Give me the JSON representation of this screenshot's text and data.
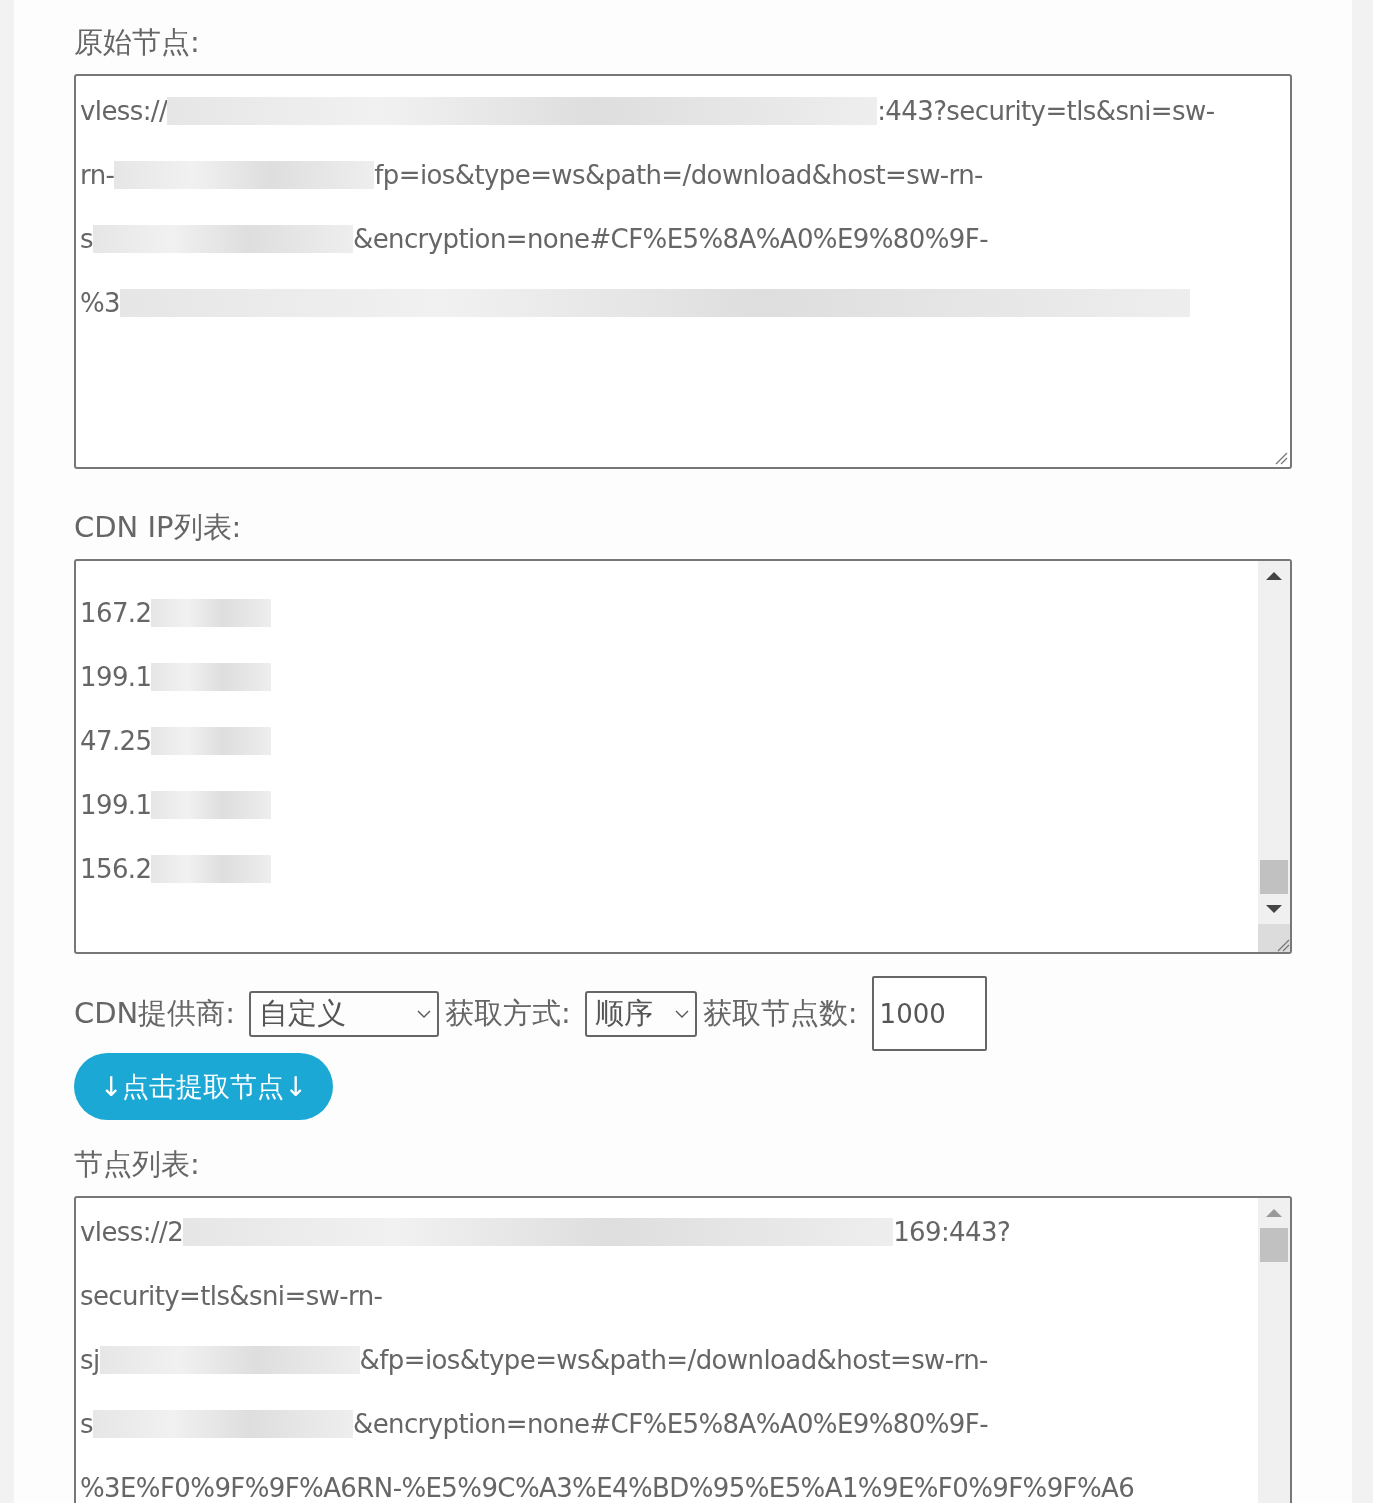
{
  "original_nodes": {
    "label": "原始节点:",
    "lines": [
      [
        {
          "kind": "text",
          "text": "vless://"
        },
        {
          "kind": "blurxl"
        },
        {
          "kind": "text",
          "text": ":443?security=tls&sni=sw-"
        }
      ],
      [
        {
          "kind": "text",
          "text": "rn-"
        },
        {
          "kind": "blurm"
        },
        {
          "kind": "text",
          "text": "fp=ios&type=ws&path=/download&host=sw-rn-"
        }
      ],
      [
        {
          "kind": "text",
          "text": "s"
        },
        {
          "kind": "blurm"
        },
        {
          "kind": "text",
          "text": "&encryption=none#CF%E5%8A%A0%E9%80%9F-"
        }
      ],
      [
        {
          "kind": "text",
          "text": "%3"
        },
        {
          "kind": "blurfull"
        }
      ]
    ]
  },
  "cdn_ip_list": {
    "label": "CDN IP列表:",
    "lines": [
      [
        {
          "kind": "text",
          "text": "167.2"
        },
        {
          "kind": "blurs"
        }
      ],
      [
        {
          "kind": "text",
          "text": "199.1"
        },
        {
          "kind": "blurs"
        }
      ],
      [
        {
          "kind": "text",
          "text": "47.25"
        },
        {
          "kind": "blurs"
        }
      ],
      [
        {
          "kind": "text",
          "text": "199.1"
        },
        {
          "kind": "blurs"
        }
      ],
      [
        {
          "kind": "text",
          "text": "156.2"
        },
        {
          "kind": "blurs"
        }
      ]
    ]
  },
  "options": {
    "provider": {
      "label": "CDN提供商:",
      "value": "自定义"
    },
    "method": {
      "label": "获取方式:",
      "value": "顺序"
    },
    "count": {
      "label": "获取节点数:",
      "value": "1000"
    }
  },
  "extract_button": "↓点击提取节点↓",
  "node_list": {
    "label": "节点列表:",
    "lines": [
      [
        {
          "kind": "text",
          "text": "vless://2"
        },
        {
          "kind": "blurxl"
        },
        {
          "kind": "text",
          "text": "169:443?"
        }
      ],
      [
        {
          "kind": "text",
          "text": "security=tls&sni=sw-rn-"
        }
      ],
      [
        {
          "kind": "text",
          "text": "sj"
        },
        {
          "kind": "blurm"
        },
        {
          "kind": "text",
          "text": "&fp=ios&type=ws&path=/download&host=sw-rn-"
        }
      ],
      [
        {
          "kind": "text",
          "text": "s"
        },
        {
          "kind": "blurm"
        },
        {
          "kind": "text",
          "text": "&encryption=none#CF%E5%8A%A0%E9%80%9F-"
        }
      ],
      [
        {
          "kind": "text",
          "text": "%3E%F0%9F%9F%A6RN-%E5%9C%A3%E4%BD%95%E5%A1%9E%F0%9F%9F%A6"
        }
      ]
    ]
  }
}
